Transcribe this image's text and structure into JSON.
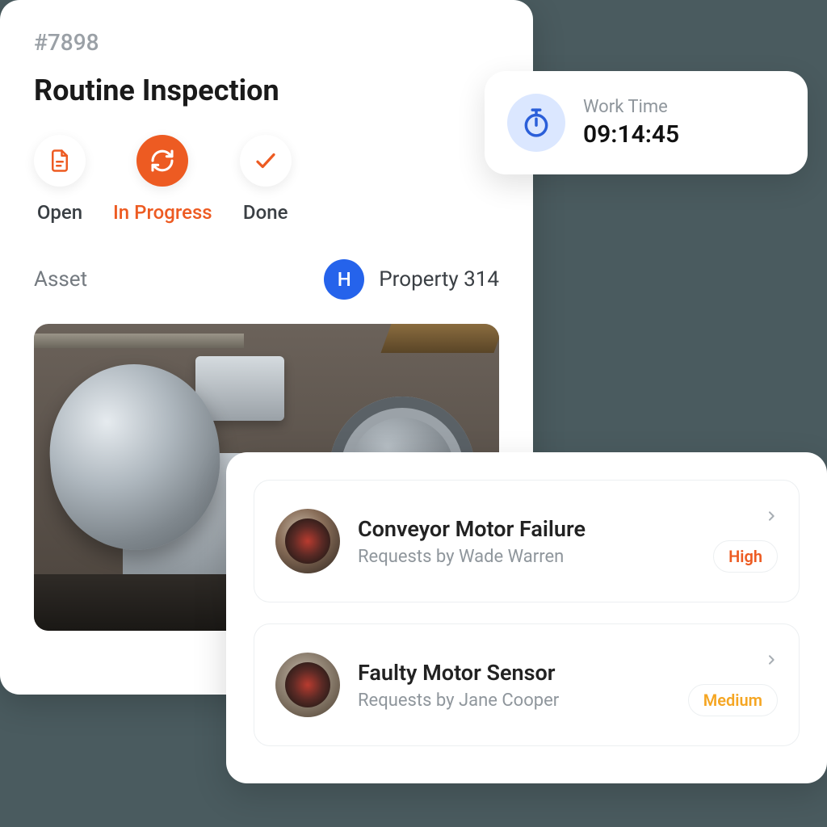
{
  "ticket": {
    "id": "#7898",
    "title": "Routine Inspection",
    "status": {
      "open": "Open",
      "in_progress": "In Progress",
      "done": "Done"
    },
    "asset_label": "Asset",
    "asset_badge": "H",
    "asset_name": "Property 314"
  },
  "work_time": {
    "icon": "stopwatch-icon",
    "label": "Work Time",
    "value": "09:14:45"
  },
  "requests": [
    {
      "title": "Conveyor Motor Failure",
      "subtitle": "Requests by Wade Warren",
      "priority": "High",
      "priority_level": "high"
    },
    {
      "title": "Faulty Motor Sensor",
      "subtitle": "Requests by Jane Cooper",
      "priority": "Medium",
      "priority_level": "medium"
    }
  ],
  "colors": {
    "accent": "#ed5b22",
    "blue": "#2563eb",
    "yellow": "#f5a623"
  }
}
